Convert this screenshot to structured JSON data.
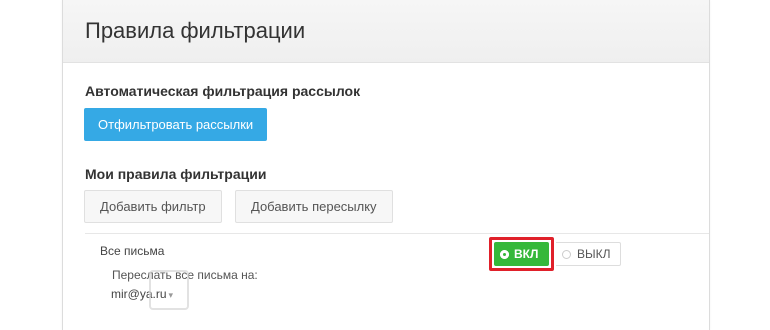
{
  "header": {
    "title": "Правила фильтрации"
  },
  "auto_filter": {
    "title": "Автоматическая фильтрация рассылок",
    "button_label": "Отфильтровать рассылки"
  },
  "my_rules": {
    "title": "Мои правила фильтрации",
    "add_filter_label": "Добавить фильтр",
    "add_forward_label": "Добавить пересылку"
  },
  "rule": {
    "label": "Все письма",
    "description": "Переслать все письма на:",
    "email": "mir@ya.ru",
    "toggle_on_label": "ВКЛ",
    "toggle_off_label": "ВЫКЛ",
    "state": "on"
  },
  "colors": {
    "primary_button": "#35a9e5",
    "toggle_on": "#35b83a",
    "highlight": "#e0202a"
  }
}
